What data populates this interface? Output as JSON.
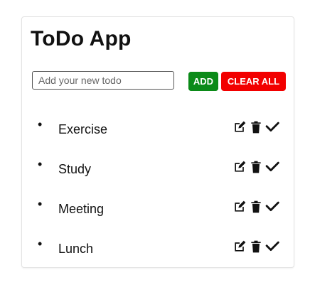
{
  "app": {
    "title": "ToDo App"
  },
  "form": {
    "input_value": "",
    "input_placeholder": "Add your new todo",
    "add_label": "ADD",
    "clear_label": "CLEAR ALL"
  },
  "todos": [
    {
      "text": "Exercise",
      "actions": [
        "edit-icon",
        "trash-icon",
        "check-icon"
      ]
    },
    {
      "text": "Study",
      "actions": [
        "edit-icon",
        "trash-icon",
        "check-icon"
      ]
    },
    {
      "text": "Meeting",
      "actions": [
        "edit-icon",
        "trash-icon",
        "check-icon"
      ]
    },
    {
      "text": "Lunch",
      "actions": [
        "edit-icon",
        "trash-icon",
        "check-icon"
      ]
    }
  ],
  "colors": {
    "add_button": "#0b8a18",
    "clear_button": "#f20000",
    "text": "#111111"
  }
}
